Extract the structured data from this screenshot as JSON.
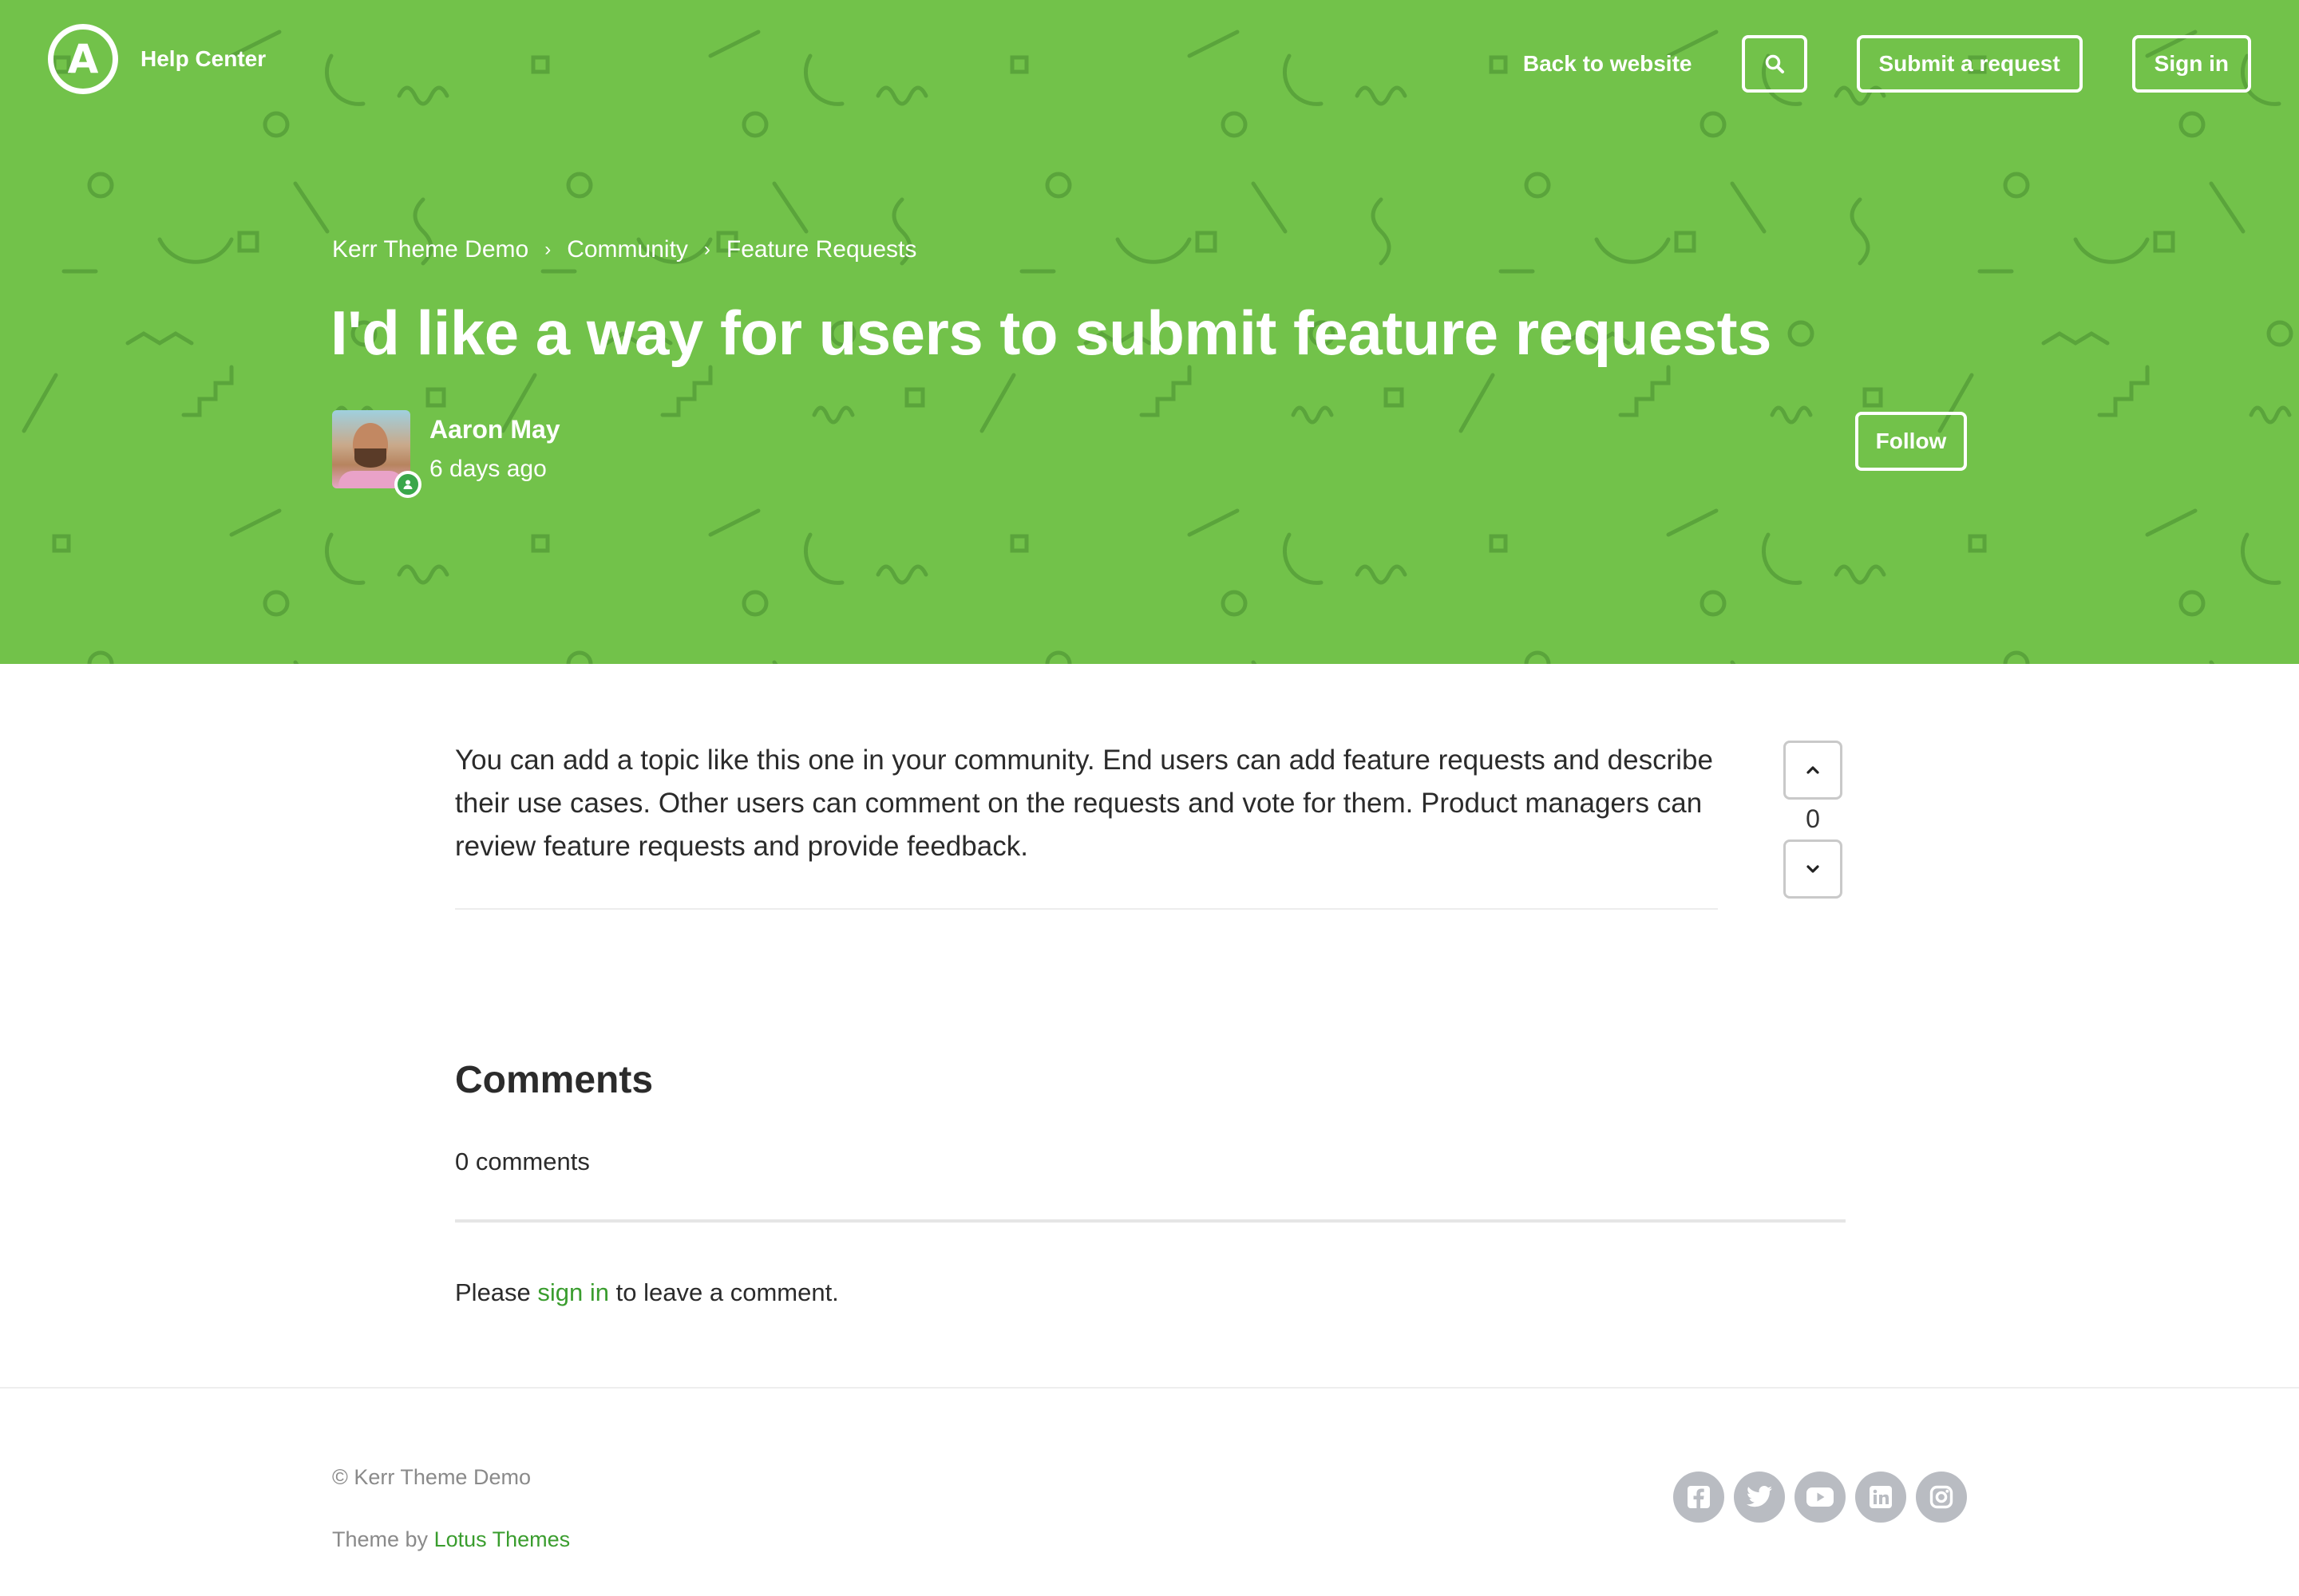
{
  "header": {
    "logo_letter": "A",
    "brand": "Help Center",
    "back_link": "Back to website",
    "search_icon": "search-icon",
    "submit_request": "Submit a request",
    "sign_in": "Sign in"
  },
  "breadcrumb": [
    "Kerr Theme Demo",
    "Community",
    "Feature Requests"
  ],
  "post": {
    "title": "I'd like a way for users to submit feature requests",
    "author": "Aaron May",
    "time": "6 days ago",
    "follow": "Follow",
    "body": "You can add a topic like this one in your community. End users can add feature requests and describe their use cases. Other users can comment on the requests and vote for them. Product managers can review feature requests and provide feedback.",
    "votes": "0"
  },
  "comments": {
    "title": "Comments",
    "count": "0 comments",
    "prompt_before": "Please",
    "prompt_link": "sign in",
    "prompt_after": "to leave a comment."
  },
  "footer": {
    "copyright": "© Kerr Theme Demo",
    "theme_prefix": "Theme by",
    "theme_link": "Lotus Themes",
    "socials": [
      "facebook-icon",
      "twitter-icon",
      "youtube-icon",
      "linkedin-icon",
      "instagram-icon"
    ]
  },
  "colors": {
    "hero_bg": "#72c24a",
    "pattern": "#5aa43b",
    "link_green": "#3a9d2e",
    "social_gray": "#b9bcc2"
  }
}
